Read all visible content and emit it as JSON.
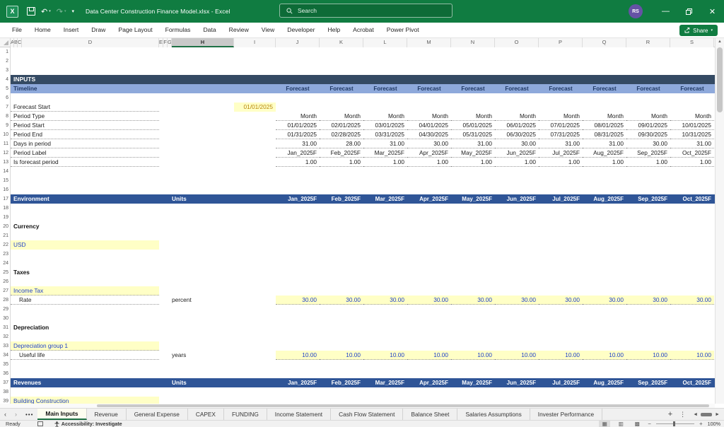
{
  "colors": {
    "title_green": "#107C41",
    "inputs_header_bg": "#344A63",
    "timeline_bg": "#8EA9DB",
    "timeline_text": "#1F3864",
    "section_blue_bg": "#2F5597",
    "input_bg": "#FFFFC6",
    "input_text": "#2041C8",
    "date_text": "#B8860B"
  },
  "title_bar": {
    "document_title": "Data Center Construction Finance Model.xlsx  -  Excel",
    "search_placeholder": "Search",
    "avatar_initials": "RS"
  },
  "ribbon": {
    "tabs": [
      "File",
      "Home",
      "Insert",
      "Draw",
      "Page Layout",
      "Formulas",
      "Data",
      "Review",
      "View",
      "Developer",
      "Help",
      "Acrobat",
      "Power Pivot"
    ],
    "share_label": "Share"
  },
  "columns": {
    "letters": [
      "A",
      "B",
      "C",
      "D",
      "E",
      "F",
      "G",
      "H",
      "I",
      "J",
      "K",
      "L",
      "M",
      "N",
      "O",
      "P",
      "Q",
      "R",
      "S"
    ],
    "widths": [
      5,
      5,
      6,
      194,
      6,
      6,
      6,
      88,
      59,
      62,
      62,
      62,
      62,
      62,
      62,
      62,
      62,
      62,
      62
    ],
    "selected": "H"
  },
  "row_count": 40,
  "grid_rows": [
    {
      "n": 4,
      "type": "banner",
      "label": "INPUTS"
    },
    {
      "n": 5,
      "type": "timeline",
      "label": "Timeline",
      "cells": [
        "Forecast",
        "Forecast",
        "Forecast",
        "Forecast",
        "Forecast",
        "Forecast",
        "Forecast",
        "Forecast",
        "Forecast",
        "Forecast"
      ]
    },
    {
      "n": 7,
      "type": "input_date",
      "label": "Forecast Start",
      "value": "01/01/2025"
    },
    {
      "n": 8,
      "type": "series",
      "label": "Period Type",
      "cells": [
        "Month",
        "Month",
        "Month",
        "Month",
        "Month",
        "Month",
        "Month",
        "Month",
        "Month",
        "Month"
      ]
    },
    {
      "n": 9,
      "type": "series",
      "label": "Period Start",
      "cells": [
        "01/01/2025",
        "02/01/2025",
        "03/01/2025",
        "04/01/2025",
        "05/01/2025",
        "06/01/2025",
        "07/01/2025",
        "08/01/2025",
        "09/01/2025",
        "10/01/2025"
      ]
    },
    {
      "n": 10,
      "type": "series",
      "label": "Period End",
      "cells": [
        "01/31/2025",
        "02/28/2025",
        "03/31/2025",
        "04/30/2025",
        "05/31/2025",
        "06/30/2025",
        "07/31/2025",
        "08/31/2025",
        "09/30/2025",
        "10/31/2025"
      ]
    },
    {
      "n": 11,
      "type": "series",
      "label": "Days in period",
      "cells": [
        "31.00",
        "28.00",
        "31.00",
        "30.00",
        "31.00",
        "30.00",
        "31.00",
        "31.00",
        "30.00",
        "31.00"
      ]
    },
    {
      "n": 12,
      "type": "series",
      "label": "Period Label",
      "cells": [
        "Jan_2025F",
        "Feb_2025F",
        "Mar_2025F",
        "Apr_2025F",
        "May_2025F",
        "Jun_2025F",
        "Jul_2025F",
        "Aug_2025F",
        "Sep_2025F",
        "Oct_2025F"
      ]
    },
    {
      "n": 13,
      "type": "series",
      "label": "Is forecast period",
      "cells": [
        "1.00",
        "1.00",
        "1.00",
        "1.00",
        "1.00",
        "1.00",
        "1.00",
        "1.00",
        "1.00",
        "1.00"
      ]
    },
    {
      "n": 17,
      "type": "section",
      "label": "Environment",
      "units": "Units",
      "cells": [
        "Jan_2025F",
        "Feb_2025F",
        "Mar_2025F",
        "Apr_2025F",
        "May_2025F",
        "Jun_2025F",
        "Jul_2025F",
        "Aug_2025F",
        "Sep_2025F",
        "Oct_2025F"
      ]
    },
    {
      "n": 20,
      "type": "heading",
      "label": "Currency"
    },
    {
      "n": 22,
      "type": "input_label",
      "label": "USD",
      "dotted": false
    },
    {
      "n": 25,
      "type": "heading",
      "label": "Taxes"
    },
    {
      "n": 27,
      "type": "input_label",
      "label": "Income Tax",
      "dotted": true
    },
    {
      "n": 28,
      "type": "input_series",
      "label": "Rate",
      "units": "percent",
      "cells": [
        "30.00",
        "30.00",
        "30.00",
        "30.00",
        "30.00",
        "30.00",
        "30.00",
        "30.00",
        "30.00",
        "30.00"
      ]
    },
    {
      "n": 31,
      "type": "heading",
      "label": "Depreciation"
    },
    {
      "n": 33,
      "type": "input_label",
      "label": "Depreciation group 1",
      "dotted": true
    },
    {
      "n": 34,
      "type": "input_series",
      "label": "Useful life",
      "units": "years",
      "cells": [
        "10.00",
        "10.00",
        "10.00",
        "10.00",
        "10.00",
        "10.00",
        "10.00",
        "10.00",
        "10.00",
        "10.00"
      ]
    },
    {
      "n": 37,
      "type": "section",
      "label": "Revenues",
      "units": "Units",
      "cells": [
        "Jan_2025F",
        "Feb_2025F",
        "Mar_2025F",
        "Apr_2025F",
        "May_2025F",
        "Jun_2025F",
        "Jul_2025F",
        "Aug_2025F",
        "Sep_2025F",
        "Oct_2025F"
      ]
    },
    {
      "n": 39,
      "type": "input_label",
      "label": "Building Construction",
      "dotted": true
    }
  ],
  "sheet_tabs": {
    "tabs": [
      "Main Inputs",
      "Revenue",
      "General Expense",
      "CAPEX",
      "FUNDING",
      "Income Statement",
      "Cash Flow Statement",
      "Balance Sheet",
      "Salaries Assumptions",
      "Invester Performance"
    ],
    "active": "Main Inputs",
    "add_label": "+"
  },
  "status_bar": {
    "mode": "Ready",
    "accessibility": "Accessibility: Investigate",
    "zoom": "100%"
  }
}
